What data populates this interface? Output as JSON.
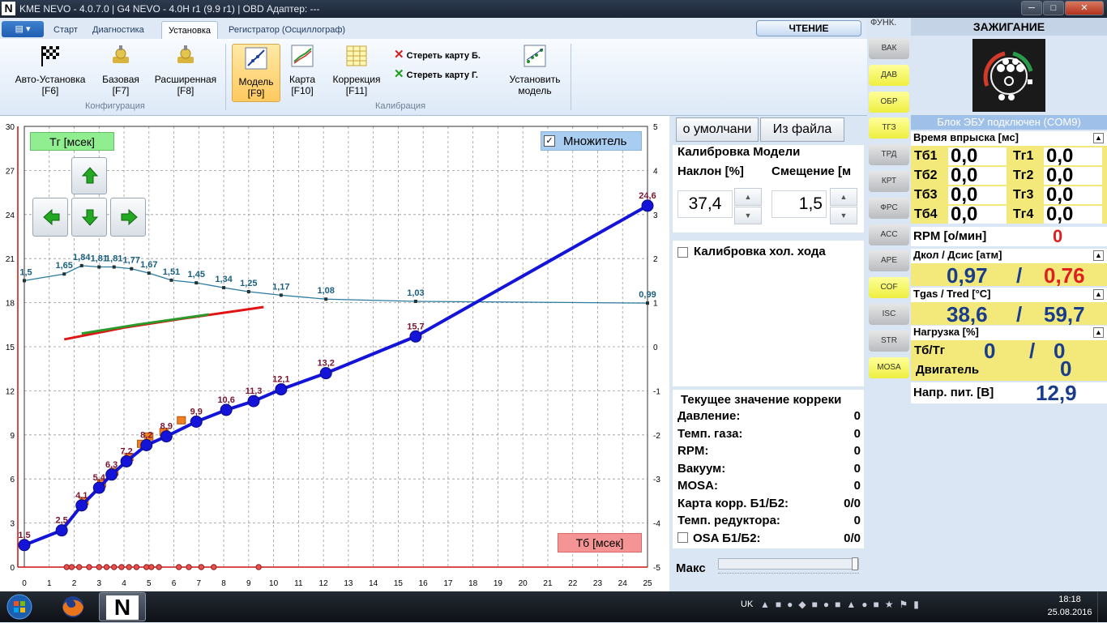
{
  "titlebar": {
    "title": "KME NEVO - 4.0.7.0  |  G4 NEVO - 4.0H r1 (9.9 r1)  |  OBD Адаптер: ---"
  },
  "tabs": [
    "Старт",
    "Диагностика",
    "Установка",
    "Регистратор (Осциллограф)"
  ],
  "read_button": "ЧТЕНИЕ",
  "ribbon": {
    "config_buttons": [
      {
        "label": "Авто-Установка",
        "key": "[F6]"
      },
      {
        "label": "Базовая",
        "key": "[F7]"
      },
      {
        "label": "Расширенная",
        "key": "[F8]"
      }
    ],
    "config_caption": "Конфигурация",
    "calib_buttons": [
      {
        "label": "Модель",
        "key": "[F9]"
      },
      {
        "label": "Карта",
        "key": "[F10]"
      },
      {
        "label": "Коррекция",
        "key": "[F11]"
      }
    ],
    "erase_b": "Стереть карту Б.",
    "erase_g": "Стереть карту Г.",
    "install_model": "Установить",
    "install_model2": "модель",
    "calib_caption": "Калибрация"
  },
  "chart_controls": {
    "tg_label": "Тг [мсек]",
    "tb_label": "Тб [мсек]",
    "multiplier_label": "Множитель",
    "multiplier_checked": "✓"
  },
  "chart_data": {
    "type": "line",
    "xlabel": "Тб [мсек]",
    "ylabel": "Тг [мсек]",
    "xlim": [
      0,
      25
    ],
    "ylim": [
      0,
      30
    ],
    "y2lim": [
      -5,
      5
    ],
    "x_ticks": [
      0,
      1,
      2,
      3,
      4,
      5,
      6,
      7,
      8,
      9,
      10,
      11,
      12,
      13,
      14,
      15,
      16,
      17,
      18,
      19,
      20,
      21,
      22,
      23,
      24,
      25
    ],
    "y_ticks": [
      0,
      3,
      6,
      9,
      12,
      15,
      18,
      21,
      24,
      27,
      30
    ],
    "y2_ticks": [
      -5,
      -4,
      -3,
      -2,
      -1,
      0,
      1,
      2,
      3,
      4,
      5
    ],
    "grid": true,
    "series": [
      {
        "name": "",
        "color": "#1414d8",
        "x": [
          0,
          1.5,
          2.3,
          3.0,
          3.5,
          4.1,
          4.9,
          5.7,
          6.9,
          8.1,
          9.2,
          10.3,
          12.1,
          15.7,
          25.0
        ],
        "y": [
          1.5,
          2.5,
          4.2,
          5.4,
          6.3,
          7.2,
          8.3,
          8.9,
          9.9,
          10.7,
          11.3,
          12.1,
          13.2,
          15.7,
          24.6
        ],
        "labels": [
          "1,5",
          "2,5",
          "4,1",
          "5,4",
          "6,3",
          "7,2",
          "8,2",
          "8,9",
          "9,9",
          "10,6",
          "11,3",
          "12,1",
          "13,2",
          "15,7",
          "24,6"
        ]
      },
      {
        "name": "",
        "color": "#2c7aa0",
        "axis": "right",
        "x": [
          0,
          1.6,
          2.3,
          3.0,
          3.6,
          4.3,
          5.0,
          5.9,
          6.9,
          8.0,
          9.0,
          10.3,
          12.1,
          15.7,
          25.0
        ],
        "y": [
          1.5,
          1.65,
          1.84,
          1.81,
          1.81,
          1.77,
          1.67,
          1.51,
          1.45,
          1.34,
          1.25,
          1.17,
          1.08,
          1.03,
          0.99
        ],
        "labels": [
          "1,5",
          "1,65",
          "1,84",
          "1,81",
          "1,81",
          "1,77",
          "1,67",
          "1,51",
          "1,45",
          "1,34",
          "1,25",
          "1,17",
          "1,08",
          "1,03",
          "0,99"
        ]
      }
    ]
  },
  "mid": {
    "btn_default": "о умолчани",
    "btn_file": "Из файла",
    "model_title": "Калибровка Модели",
    "slope_label": "Наклон [%]",
    "offset_label": "Смещение [м",
    "slope_value": "37,4",
    "offset_value": "1,5",
    "idle_label": "Калибровка хол. хода",
    "corr_title": "Текущее значение корреки",
    "corr_rows": [
      {
        "label": "Давление:",
        "value": "0"
      },
      {
        "label": "Темп. газа:",
        "value": "0"
      },
      {
        "label": "RPM:",
        "value": "0"
      },
      {
        "label": "Вакуум:",
        "value": "0"
      },
      {
        "label": "MOSA:",
        "value": "0"
      },
      {
        "label": "Карта корр. Б1/Б2:",
        "value": "0/0"
      },
      {
        "label": "Темп. редуктора:",
        "value": "0"
      },
      {
        "label": "OSA Б1/Б2:",
        "value": "0/0"
      }
    ],
    "max_label": "Макс"
  },
  "funk": {
    "title": "ФУНК.",
    "buttons": [
      {
        "label": "ВАК",
        "on": false
      },
      {
        "label": "ДАВ",
        "on": true
      },
      {
        "label": "ОБР",
        "on": true
      },
      {
        "label": "ТГЗ",
        "on": true
      },
      {
        "label": "ТРД",
        "on": false
      },
      {
        "label": "КРТ",
        "on": false
      },
      {
        "label": "ФРС",
        "on": false
      },
      {
        "label": "ACC",
        "on": false
      },
      {
        "label": "APE",
        "on": false
      },
      {
        "label": "COF",
        "on": true
      },
      {
        "label": "ISC",
        "on": false
      },
      {
        "label": "STR",
        "on": false
      },
      {
        "label": "MOSA",
        "on": true
      }
    ]
  },
  "right": {
    "ignition": "ЗАЖИГАНИЕ",
    "ecu_status": "Блок ЭБУ подключен (COM9)",
    "inj_title": "Время впрыска [мс]",
    "inj": [
      {
        "lb": "Тб1",
        "vb": "0,0",
        "lg": "Тг1",
        "vg": "0,0"
      },
      {
        "lb": "Тб2",
        "vb": "0,0",
        "lg": "Тг2",
        "vg": "0,0"
      },
      {
        "lb": "Тб3",
        "vb": "0,0",
        "lg": "Тг3",
        "vg": "0,0"
      },
      {
        "lb": "Тб4",
        "vb": "0,0",
        "lg": "Тг4",
        "vg": "0,0"
      }
    ],
    "rpm_label": "RPM [о/мин]",
    "rpm_value": "0",
    "press_label": "Дкол / Дсис [атм]",
    "press_1": "0,97",
    "press_sep": "/",
    "press_2": "0,76",
    "temp_label": "Tgas / Tred [°C]",
    "temp_1": "38,6",
    "temp_sep": "/",
    "temp_2": "59,7",
    "load_label": "Нагрузка [%]",
    "load_tbtg": "Тб/Тг",
    "load_1": "0",
    "load_sep": "/",
    "load_2": "0",
    "load_engine": "Двигатель",
    "load_engine_val": "0",
    "volt_label": "Напр. пит. [В]",
    "volt_value": "12,9"
  },
  "taskbar": {
    "lang": "UK",
    "time": "18:18",
    "date": "25.08.2016"
  }
}
